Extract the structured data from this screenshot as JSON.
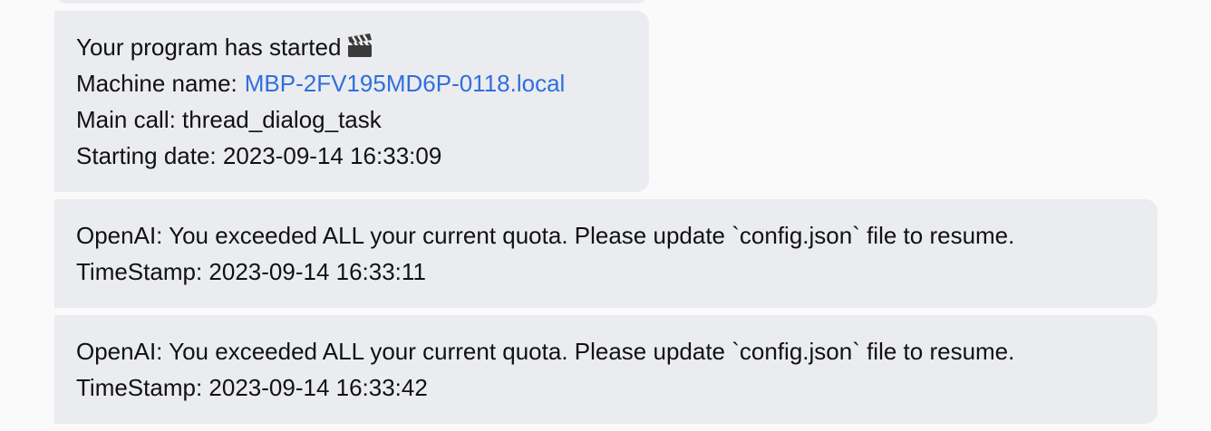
{
  "messages": [
    {
      "type": "program-started",
      "title": "Your program has started",
      "title_icon": "clapperboard-icon",
      "machine_label": "Machine name:",
      "machine_name": "MBP-2FV195MD6P-0118.local",
      "main_call": "Main call: thread_dialog_task",
      "starting_date": "Starting date: 2023-09-14 16:33:09"
    },
    {
      "type": "quota-error",
      "text": "OpenAI: You exceeded ALL your current quota. Please update `config.json` file to resume.",
      "timestamp": "TimeStamp: 2023-09-14 16:33:11"
    },
    {
      "type": "quota-error",
      "text": "OpenAI: You exceeded ALL your current quota. Please update `config.json` file to resume.",
      "timestamp": "TimeStamp: 2023-09-14 16:33:42"
    }
  ],
  "colors": {
    "background": "#fafafb",
    "bubble": "#ebecef",
    "text": "#111111",
    "link": "#2f6fde"
  }
}
